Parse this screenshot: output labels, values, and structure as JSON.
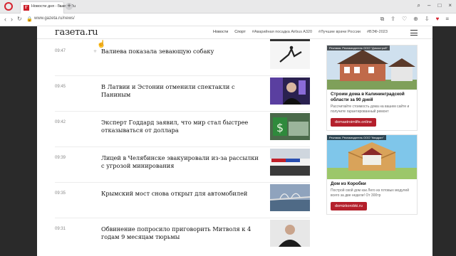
{
  "browser": {
    "tab_title": "Новости дня - Газета.Ru",
    "tab_favicon": "Г",
    "url": "www.gazeta.ru/news/"
  },
  "site": {
    "logo": "газета.ru",
    "nav": [
      "Новости",
      "Спорт",
      "#Аварийная посадка Airbus A320",
      "#Лучшие врачи России",
      "#ВЭФ-2023"
    ]
  },
  "news": [
    {
      "time": "09:47",
      "title": "Валиева показала зевающую собаку"
    },
    {
      "time": "09:45",
      "title": "В Латвии и Эстонии отменили спектакли с Паниным"
    },
    {
      "time": "09:42",
      "title": "Эксперт Годдард заявил, что мир стал быстрее отказываться от доллара"
    },
    {
      "time": "09:39",
      "title": "Лицей в Челябинске эвакуировали из-за рассылки с угрозой минирования"
    },
    {
      "time": "09:35",
      "title": "Крымский мост снова открыт для автомобилей"
    },
    {
      "time": "09:31",
      "title": "Обвинение попросило приговорить Митволя к 4 годам 9 месяцам тюрьмы"
    }
  ],
  "ads": [
    {
      "badge": "Реклама. Рекламодатель ООО \"Домострой\"",
      "title": "Строим дома в Калининградской области за 90 дней",
      "desc": "Рассчитайте стоимость дома на вашем сайте и получите гарантированный ремонт",
      "button": "domastroimlife.online"
    },
    {
      "badge": "Реклама. Рекламодатель ООО \"Квадрат\"",
      "title": "Дом из Коробки",
      "desc": "Построй свой дом как Лего из готовых модулей всего за две недели! От 300тр",
      "button": "domizkorobki.ru"
    }
  ],
  "colors": {
    "brand": "#cc1f2a",
    "ad_button": "#b41f2b"
  }
}
